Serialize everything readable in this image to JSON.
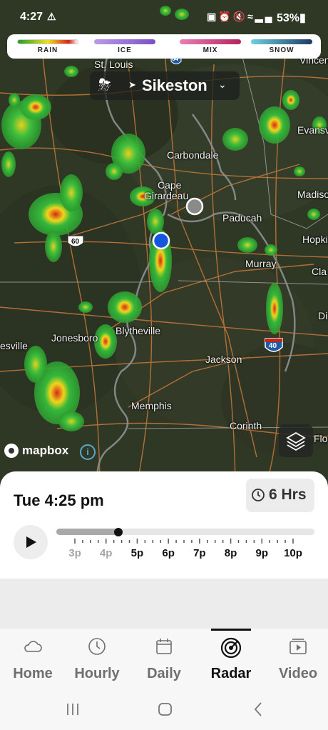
{
  "status_bar": {
    "time": "4:27",
    "battery": "53%"
  },
  "legend": {
    "items": [
      {
        "label": "RAIN",
        "colors": [
          "#1e9e2a",
          "#f0e020",
          "#d82020",
          "#ffffff"
        ]
      },
      {
        "label": "ICE",
        "colors": [
          "#b99be6",
          "#7b4fc9"
        ]
      },
      {
        "label": "MIX",
        "colors": [
          "#e97fb3",
          "#b5235f"
        ]
      },
      {
        "label": "SNOW",
        "colors": [
          "#6fd0df",
          "#1d3a63"
        ]
      }
    ]
  },
  "location": {
    "name": "Sikeston",
    "weather_icon": "thunderstorm-cloud-icon"
  },
  "map": {
    "cities": [
      {
        "name": "St. Louis"
      },
      {
        "name": "Vincen"
      },
      {
        "name": "Evansv"
      },
      {
        "name": "Carbondale"
      },
      {
        "name": "Cape"
      },
      {
        "name": "Girardeau"
      },
      {
        "name": "Madiso"
      },
      {
        "name": "Paducah"
      },
      {
        "name": "Hopkin"
      },
      {
        "name": "Murray"
      },
      {
        "name": "Cla"
      },
      {
        "name": "Di"
      },
      {
        "name": "Blytheville"
      },
      {
        "name": "Jonesboro"
      },
      {
        "name": "esville"
      },
      {
        "name": "Jackson"
      },
      {
        "name": "Memphis"
      },
      {
        "name": "Corinth"
      },
      {
        "name": "Flo"
      }
    ],
    "shields": {
      "us60": "60",
      "i40": "40",
      "i64": "64"
    },
    "attribution": "mapbox"
  },
  "timeline": {
    "datetime": "Tue 4:25 pm",
    "range_label": "6 Hrs",
    "progress": 0.24,
    "hours": [
      {
        "label": "3p",
        "past": true
      },
      {
        "label": "4p",
        "past": true
      },
      {
        "label": "5p",
        "past": false
      },
      {
        "label": "6p",
        "past": false
      },
      {
        "label": "7p",
        "past": false
      },
      {
        "label": "8p",
        "past": false
      },
      {
        "label": "9p",
        "past": false
      },
      {
        "label": "10p",
        "past": false
      }
    ]
  },
  "nav": {
    "items": [
      {
        "label": "Home",
        "icon": "cloud-icon",
        "active": false
      },
      {
        "label": "Hourly",
        "icon": "clock-icon",
        "active": false
      },
      {
        "label": "Daily",
        "icon": "calendar-icon",
        "active": false
      },
      {
        "label": "Radar",
        "icon": "radar-icon",
        "active": true
      },
      {
        "label": "Video",
        "icon": "video-icon",
        "active": false
      }
    ]
  }
}
